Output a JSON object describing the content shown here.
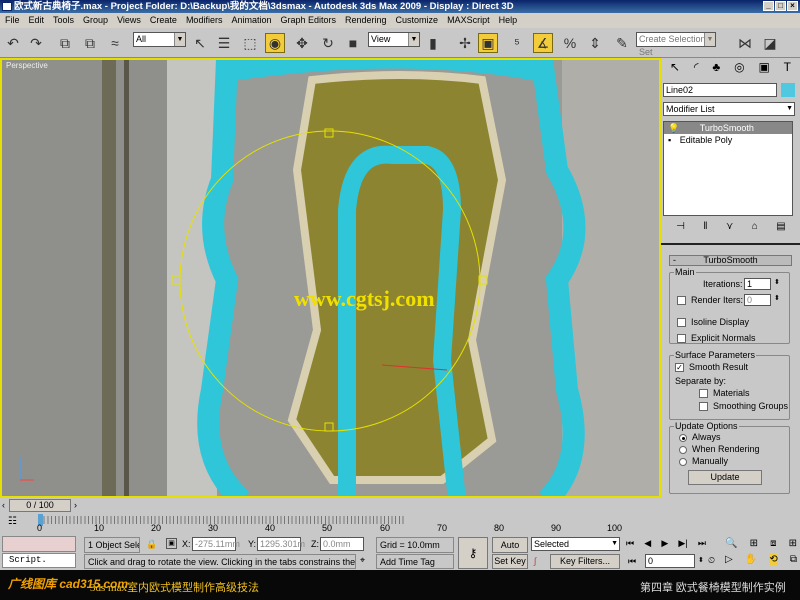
{
  "title": "欧式新古典椅子.max     - Project Folder: D:\\Backup\\我的文档\\3dsmax     - Autodesk 3ds Max  2009     - Display : Direct 3D",
  "menu": [
    "File",
    "Edit",
    "Tools",
    "Group",
    "Views",
    "Create",
    "Modifiers",
    "Animation",
    "Graph Editors",
    "Rendering",
    "Customize",
    "MAXScript",
    "Help"
  ],
  "toolbar": {
    "selection_filter": "All",
    "ref_coord": "View",
    "named_selection_placeholder": "Create Selection Set"
  },
  "viewport": {
    "label": "Perspective",
    "watermark": "www.cgtsj.com"
  },
  "panel": {
    "object_name": "Line02",
    "object_color": "#4fc8e0",
    "modifier_list": "Modifier List",
    "stack": [
      "TurboSmooth",
      "Editable Poly"
    ],
    "rollout": "TurboSmooth",
    "main": {
      "label": "Main",
      "iterations_label": "Iterations:",
      "iterations": "1",
      "render_iters_label": "Render Iters:",
      "render_iters": "0",
      "render_iters_checked": false,
      "isoline": "Isoline Display",
      "isoline_checked": false,
      "explicit": "Explicit Normals",
      "explicit_checked": false
    },
    "surface": {
      "label": "Surface Parameters",
      "smooth": "Smooth Result",
      "smooth_checked": true,
      "separate": "Separate by:",
      "materials": "Materials",
      "smoothing_groups": "Smoothing Groups"
    },
    "update": {
      "label": "Update Options",
      "always": "Always",
      "when_rendering": "When Rendering",
      "manually": "Manually",
      "selected": "Always",
      "button": "Update"
    }
  },
  "timeline": {
    "frame": "0 / 100",
    "ticks": [
      "0",
      "10",
      "20",
      "30",
      "40",
      "50",
      "60",
      "70",
      "80",
      "90",
      "100"
    ]
  },
  "status": {
    "selection": "1 Object Sele",
    "x_label": "X:",
    "x": "-275.11mm",
    "y_label": "Y:",
    "y": "1295.301m",
    "z_label": "Z:",
    "z": "0.0mm",
    "grid": "Grid = 10.0mm",
    "prompt": "Click and drag to rotate the view.  Clicking in the tabs constrains the rota",
    "add_time_tag": "Add Time Tag",
    "auto_key": "Auto Key",
    "set_key": "Set Key",
    "key_mode": "Selected",
    "key_filters": "Key Filters...",
    "current_frame": "0",
    "script": "Script."
  },
  "banner": {
    "logo": "广线图库 cad315.com",
    "course": "3ds max室内欧式模型制作高级技法",
    "chapter": "第四章 欧式餐椅模型制作实例"
  }
}
